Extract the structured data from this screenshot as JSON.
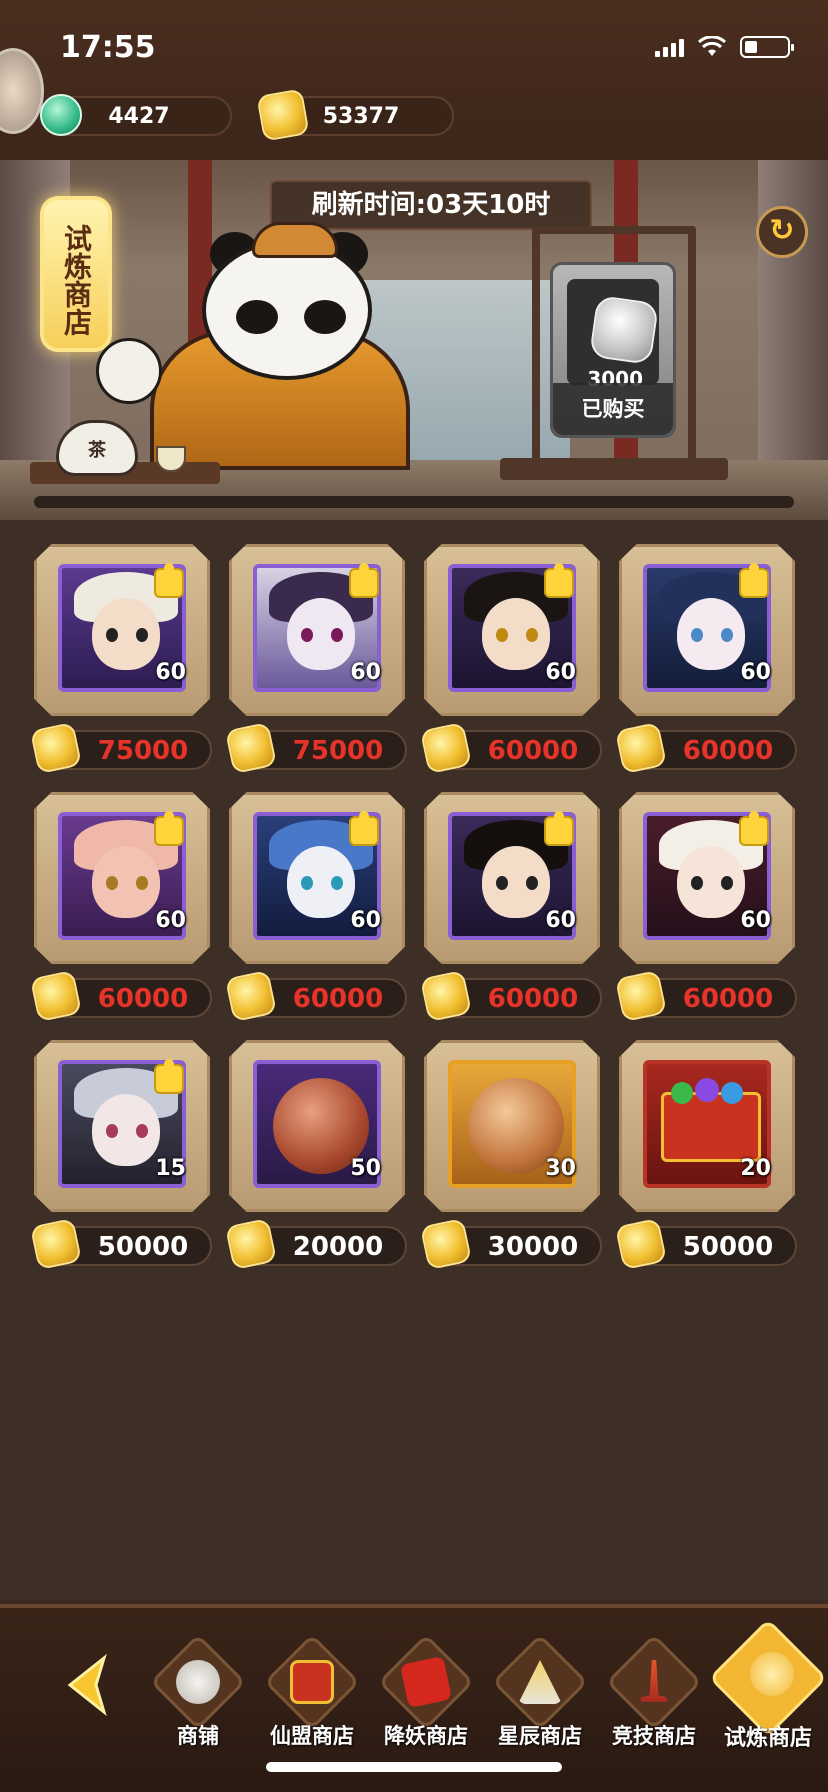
{
  "status_bar": {
    "time": "17:55"
  },
  "currency": {
    "jade": "4427",
    "gold": "53377"
  },
  "shop": {
    "sign": "试炼商店",
    "refresh_time": "刷新时间:03天10时",
    "refresh_icon": "refresh-icon",
    "featured": {
      "price": "3000",
      "status": "已购买",
      "coin": "silver"
    }
  },
  "items": [
    {
      "qty": "60",
      "price": "75000",
      "price_color": "red",
      "kind": "hero-shard"
    },
    {
      "qty": "60",
      "price": "75000",
      "price_color": "red",
      "kind": "hero-shard"
    },
    {
      "qty": "60",
      "price": "60000",
      "price_color": "red",
      "kind": "hero-shard"
    },
    {
      "qty": "60",
      "price": "60000",
      "price_color": "red",
      "kind": "hero-shard"
    },
    {
      "qty": "60",
      "price": "60000",
      "price_color": "red",
      "kind": "hero-shard"
    },
    {
      "qty": "60",
      "price": "60000",
      "price_color": "red",
      "kind": "hero-shard"
    },
    {
      "qty": "60",
      "price": "60000",
      "price_color": "red",
      "kind": "hero-shard"
    },
    {
      "qty": "60",
      "price": "60000",
      "price_color": "red",
      "kind": "hero-shard"
    },
    {
      "qty": "15",
      "price": "50000",
      "price_color": "white",
      "kind": "hero-shard"
    },
    {
      "qty": "50",
      "price": "20000",
      "price_color": "white",
      "kind": "token"
    },
    {
      "qty": "30",
      "price": "30000",
      "price_color": "white",
      "kind": "token"
    },
    {
      "qty": "20",
      "price": "50000",
      "price_color": "white",
      "kind": "chest"
    }
  ],
  "nav": {
    "items": [
      {
        "label": "商铺",
        "icon": "panda-icon"
      },
      {
        "label": "仙盟商店",
        "icon": "banner-icon"
      },
      {
        "label": "降妖商店",
        "icon": "red-bag-icon"
      },
      {
        "label": "星辰商店",
        "icon": "pagoda-icon"
      },
      {
        "label": "竞技商店",
        "icon": "sword-icon"
      },
      {
        "label": "试炼商店",
        "icon": "trial-icon"
      }
    ]
  },
  "colors": {
    "accent_gold": "#f2c032",
    "price_red": "#e8332a",
    "frame_purple": "#8a5fd6"
  }
}
